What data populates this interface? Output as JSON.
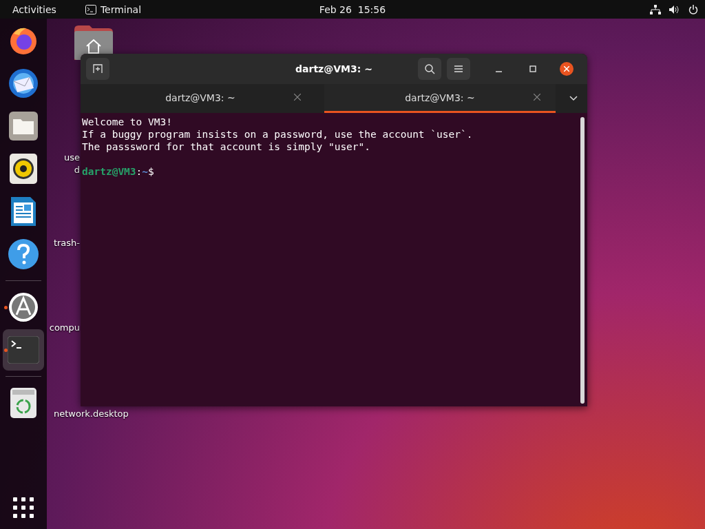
{
  "top_bar": {
    "activities": "Activities",
    "app_name": "Terminal",
    "clock": "Feb 26  15:56"
  },
  "dock": {
    "items": [
      {
        "kind": "firefox",
        "running": false,
        "selected": false
      },
      {
        "kind": "mail",
        "running": false,
        "selected": false
      },
      {
        "kind": "files",
        "running": false,
        "selected": false
      },
      {
        "kind": "music",
        "running": false,
        "selected": false
      },
      {
        "kind": "writer",
        "running": false,
        "selected": false
      },
      {
        "kind": "help",
        "running": false,
        "selected": false
      },
      {
        "kind": "software",
        "running": true,
        "selected": false
      },
      {
        "kind": "terminal",
        "running": true,
        "selected": true
      },
      {
        "kind": "trash",
        "running": false,
        "selected": false
      }
    ]
  },
  "desktop_icons": [
    {
      "kind": "home"
    },
    {
      "kind": "file",
      "label_lines": [
        "use",
        "d"
      ]
    },
    {
      "kind": "file",
      "label_lines": [
        "trash-"
      ]
    },
    {
      "kind": "file",
      "label_lines": [
        "compu"
      ]
    },
    {
      "kind": "file",
      "label_lines": [
        "network.desktop"
      ]
    }
  ],
  "window": {
    "title": "dartz@VM3: ~",
    "tabs": [
      {
        "label": "dartz@VM3: ~",
        "selected": false
      },
      {
        "label": "dartz@VM3: ~",
        "selected": true
      }
    ],
    "output": [
      "Welcome to VM3!",
      "If a buggy program insists on a password, use the account `user`.",
      "The passsword for that account is simply \"user\"."
    ],
    "prompt": {
      "user_host": "dartz@VM3",
      "separator": ":",
      "path": "~",
      "symbol": "$"
    }
  }
}
